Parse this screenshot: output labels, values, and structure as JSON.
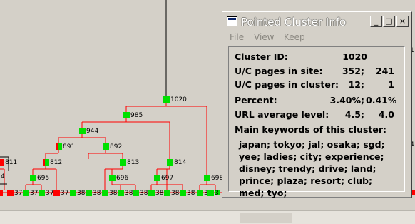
{
  "window": {
    "title": "Pointed Cluster Info",
    "controls": {
      "minimize": "_",
      "maximize": "□",
      "close": "×"
    },
    "menu": [
      "File",
      "View",
      "Keep"
    ]
  },
  "info": {
    "cluster_id_label": "Cluster ID:",
    "cluster_id": "1020",
    "uc_site_label": "U/C pages in site:",
    "uc_site_u": "352;",
    "uc_site_c": "241",
    "uc_cluster_label": "U/C pages in cluster:",
    "uc_cluster_u": "12;",
    "uc_cluster_c": "1",
    "percent_label": "Percent:",
    "percent_u": "3.40%;",
    "percent_c": "0.41%",
    "url_level_label": "URL average level:",
    "url_level_u": "4.5;",
    "url_level_c": "4.0",
    "keywords_label": "Main keywords of this cluster:",
    "keywords": "japan; tokyo; jal; osaka; sgd; yee; ladies; city; experience; disney; trendy; drive; land; prince; plaza; resort; club; med; tyo;"
  },
  "tree": {
    "colors": {
      "line": "#ff0000",
      "node": "#00e000",
      "leaf_red": "#ff0000",
      "trunk": "#000000"
    },
    "nodes": [
      {
        "id": "root",
        "label": "1020",
        "parent": null
      },
      {
        "id": "n985",
        "label": "985",
        "parent": "root"
      },
      {
        "id": "n944",
        "label": "944",
        "parent": "n985"
      },
      {
        "id": "n891",
        "label": "891",
        "parent": "n944"
      },
      {
        "id": "n892",
        "label": "892",
        "parent": "n944"
      },
      {
        "id": "n812",
        "label": "812",
        "parent": "n891"
      },
      {
        "id": "n813",
        "label": "813",
        "parent": "n892"
      },
      {
        "id": "n814",
        "label": "814",
        "parent": "n985"
      },
      {
        "id": "n695",
        "label": "695",
        "parent": "n812"
      },
      {
        "id": "n696",
        "label": "696",
        "parent": "n813"
      },
      {
        "id": "n697",
        "label": "697",
        "parent": "n814"
      },
      {
        "id": "n698",
        "label": "698",
        "parent": "root"
      },
      {
        "id": "n811",
        "label": "811",
        "parent": null
      }
    ],
    "leaves": [
      {
        "label": "37",
        "color": "leaf_red"
      },
      {
        "label": "37",
        "color": "node"
      },
      {
        "label": "37",
        "color": "node"
      },
      {
        "label": "37",
        "color": "leaf_red"
      },
      {
        "label": "38",
        "color": "node"
      },
      {
        "label": "38",
        "color": "node"
      },
      {
        "label": "38",
        "color": "node"
      },
      {
        "label": "38",
        "color": "node"
      },
      {
        "label": "38",
        "color": "node"
      },
      {
        "label": "38",
        "color": "node"
      },
      {
        "label": "38",
        "color": "node"
      },
      {
        "label": "38",
        "color": "node"
      },
      {
        "label": "38",
        "color": "node"
      },
      {
        "label": "3",
        "color": "node"
      }
    ],
    "edge_label_4": "4",
    "edge_label_1": "1",
    "edge_label_4b": "4"
  }
}
